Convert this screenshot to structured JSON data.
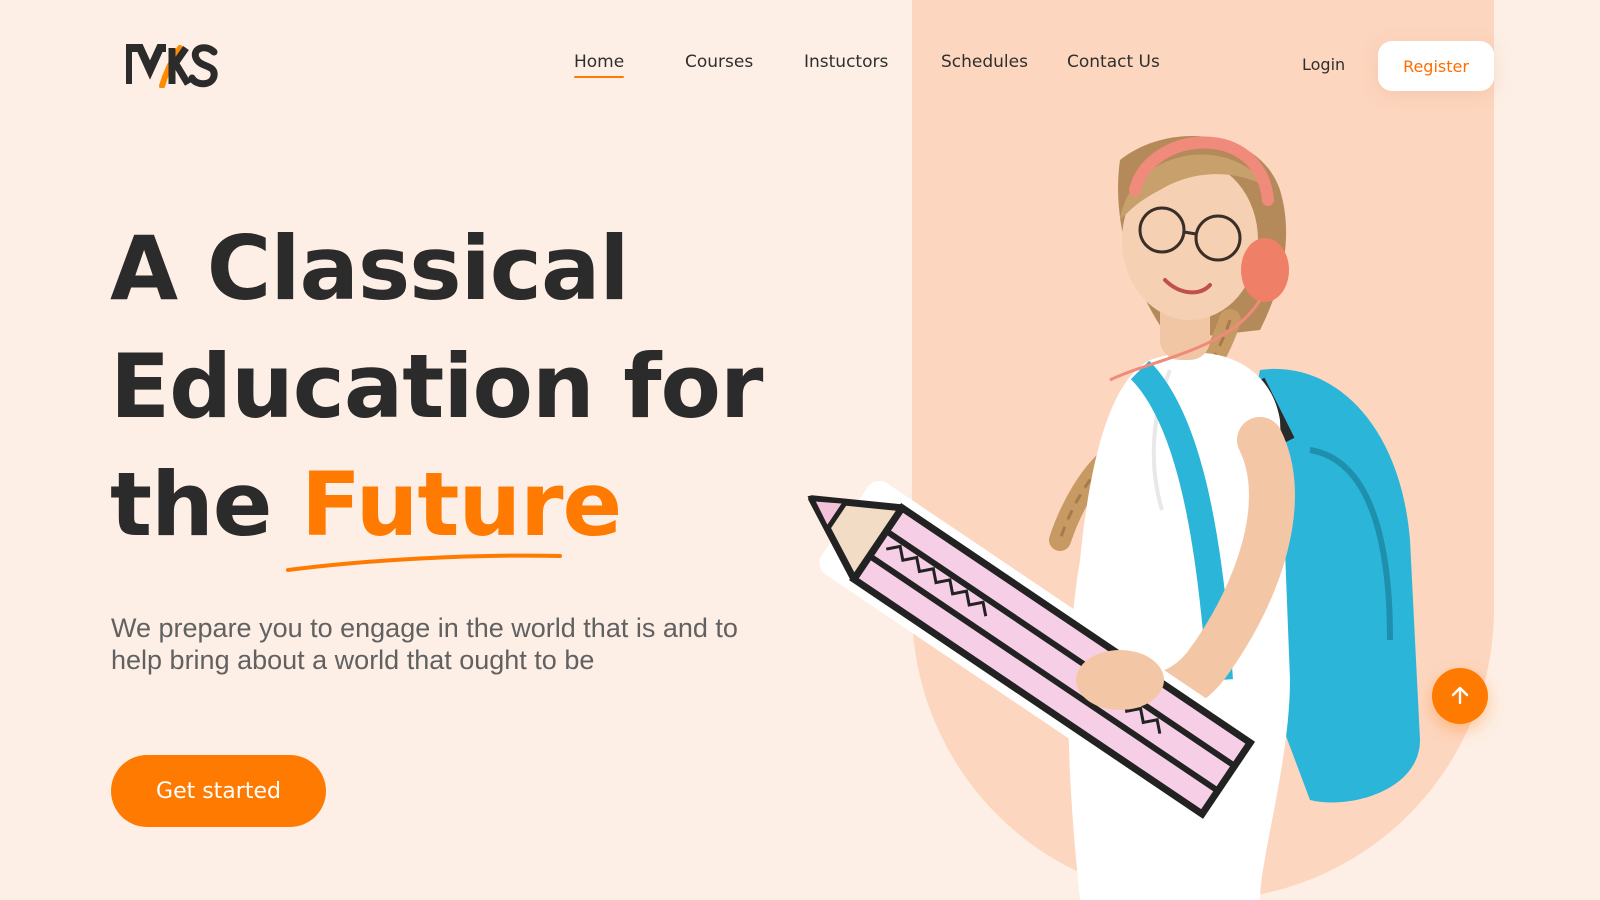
{
  "brand": {
    "logo_text": "MKS",
    "accent_color": "#ff7a00",
    "background_color": "#fdefe5",
    "panel_color": "#fdd6bf"
  },
  "nav": {
    "items": [
      {
        "label": "Home",
        "active": true
      },
      {
        "label": "Courses",
        "active": false
      },
      {
        "label": "Instuctors",
        "active": false
      },
      {
        "label": "Schedules",
        "active": false
      },
      {
        "label": "Contact Us",
        "active": false
      }
    ],
    "login_label": "Login",
    "register_label": "Register"
  },
  "hero": {
    "headline_line1": "A Classical",
    "headline_line2": "Education for",
    "headline_line3_prefix": "the",
    "headline_accent": "Future",
    "subtext": "We prepare you to engage in the world that is and to help bring about a world that ought to be",
    "cta_label": "Get started"
  },
  "icons": {
    "scroll_top": "arrow-up-icon"
  }
}
